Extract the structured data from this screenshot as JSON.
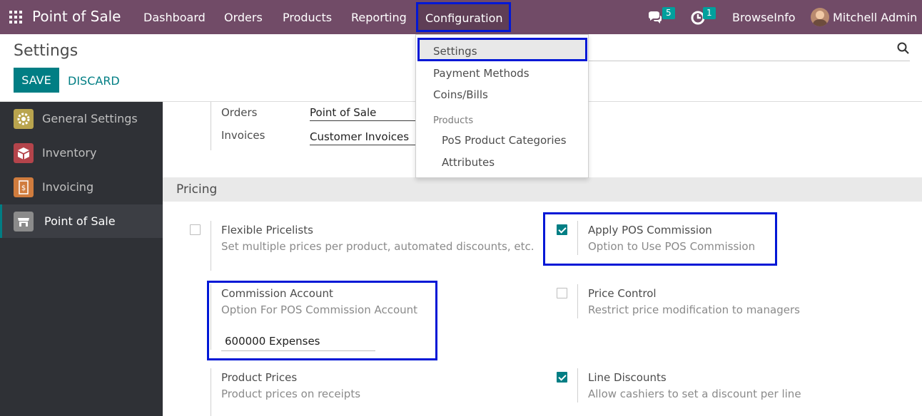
{
  "navbar": {
    "app_name": "Point of Sale",
    "menu": [
      "Dashboard",
      "Orders",
      "Products",
      "Reporting"
    ],
    "active_menu": "Configuration",
    "messages_count": "5",
    "activities_count": "1",
    "company": "BrowseInfo",
    "user": "Mitchell Admin"
  },
  "control": {
    "title": "Settings",
    "save_label": "SAVE",
    "discard_label": "DISCARD"
  },
  "sidebar": {
    "items": [
      {
        "label": "General Settings",
        "color": "#b9a44e"
      },
      {
        "label": "Inventory",
        "color": "#b4444b"
      },
      {
        "label": "Invoicing",
        "color": "#d07c3e"
      },
      {
        "label": "Point of Sale",
        "color": "#8b8b8b"
      }
    ]
  },
  "journals": {
    "orders_label": "Orders",
    "orders_value": "Point of Sale",
    "invoices_label": "Invoices",
    "invoices_value": "Customer Invoices"
  },
  "pricing": {
    "section_title": "Pricing",
    "flexible_pricelists": {
      "title": "Flexible Pricelists",
      "desc": "Set multiple prices per product, automated discounts, etc.",
      "checked": false
    },
    "apply_pos_commission": {
      "title": "Apply POS Commission",
      "desc": "Option to Use POS Commission",
      "checked": true
    },
    "commission_account": {
      "title": "Commission Account",
      "desc": "Option For POS Commission Account",
      "value": "600000 Expenses"
    },
    "price_control": {
      "title": "Price Control",
      "desc": "Restrict price modification to managers",
      "checked": false
    },
    "product_prices": {
      "title": "Product Prices",
      "desc": "Product prices on receipts"
    },
    "line_discounts": {
      "title": "Line Discounts",
      "desc": "Allow cashiers to set a discount per line",
      "checked": true
    }
  },
  "dropdown": {
    "settings": "Settings",
    "payment_methods": "Payment Methods",
    "coins_bills": "Coins/Bills",
    "products_header": "Products",
    "pos_product_categories": "PoS Product Categories",
    "attributes": "Attributes"
  },
  "colors": {
    "navbar": "#714b67",
    "accent": "#017e84",
    "highlight": "#0018d6",
    "sidebar": "#2f3136"
  }
}
